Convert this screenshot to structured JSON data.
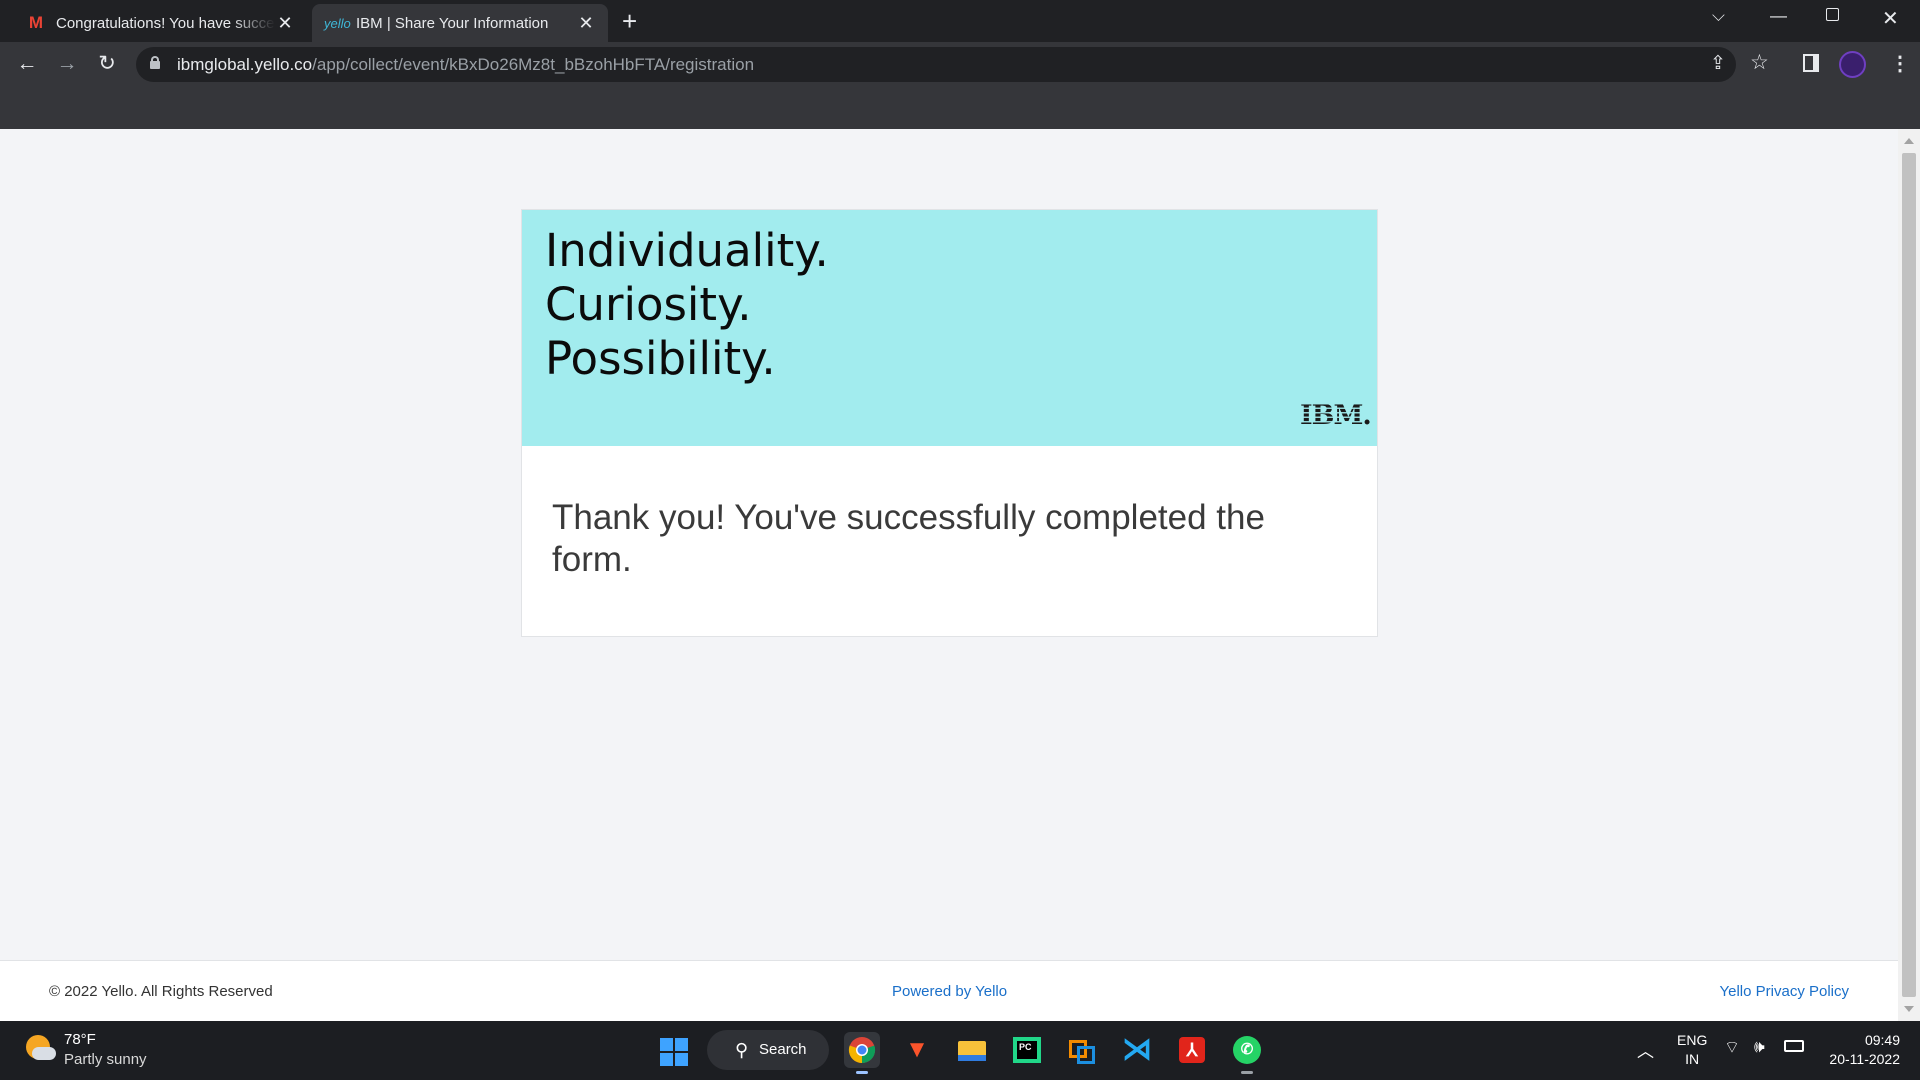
{
  "browser": {
    "tabs": [
      {
        "title": "Congratulations! You have succe",
        "favicon": "gmail-icon"
      },
      {
        "title": "IBM | Share Your Information",
        "favicon": "yello-icon",
        "favicon_text": "yello"
      }
    ],
    "url_host": "ibmglobal.yello.co",
    "url_path": "/app/collect/event/kBxDo26Mz8t_bBzohHbFTA/registration"
  },
  "hero": {
    "lines": [
      "Individuality.",
      "Curiosity.",
      "Possibility."
    ],
    "logo_text": "IBM.",
    "bg_color": "#a2ecee"
  },
  "message": "Thank you! You've successfully completed the form.",
  "footer": {
    "copyright": "© 2022 Yello. All Rights Reserved",
    "powered": "Powered by Yello",
    "privacy": "Yello Privacy Policy",
    "link_color": "#1a6fc9"
  },
  "taskbar": {
    "weather_temp": "78°F",
    "weather_desc": "Partly sunny",
    "search_label": "Search",
    "apps": [
      "chrome-icon",
      "brave-icon",
      "file-explorer-icon",
      "pycharm-icon",
      "vmware-icon",
      "vscode-icon",
      "acrobat-icon",
      "whatsapp-icon"
    ],
    "lang_top": "ENG",
    "lang_bottom": "IN",
    "time": "09:49",
    "date": "20-11-2022"
  }
}
